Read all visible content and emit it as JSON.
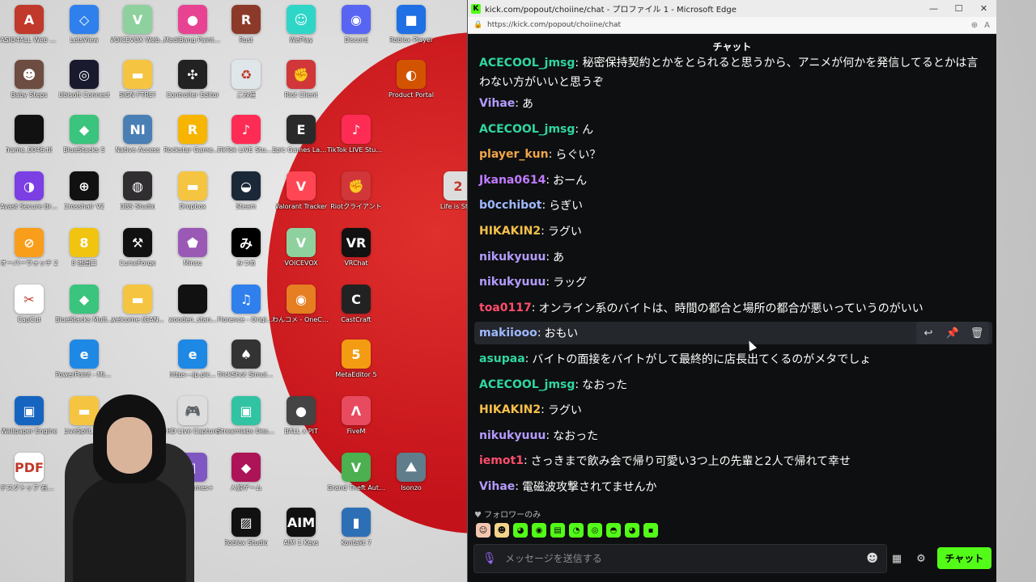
{
  "desktop": {
    "icons": [
      {
        "label": "ASIO4ALL Web Site",
        "color": "#c0392b",
        "glyph": "A"
      },
      {
        "label": "LetsView",
        "color": "#2f80ed",
        "glyph": "◇"
      },
      {
        "label": "VOICEVOX Web...",
        "color": "#8fd19e",
        "glyph": "V"
      },
      {
        "label": "MediBang Paint Pro",
        "color": "#e84393",
        "glyph": "●"
      },
      {
        "label": "Rust",
        "color": "#8b3a2a",
        "glyph": "R"
      },
      {
        "label": "WePlay",
        "color": "#2ed6c8",
        "glyph": "☺"
      },
      {
        "label": "Discord",
        "color": "#5865f2",
        "glyph": "◉"
      },
      {
        "label": "Roblox Player",
        "color": "#1f6fe5",
        "glyph": "■"
      },
      {
        "label": "Baby Steps",
        "color": "#6d4c41",
        "glyph": "☻"
      },
      {
        "label": "Ubisoft Connect",
        "color": "#1a1a2e",
        "glyph": "◎"
      },
      {
        "label": "SIGN FTRE?",
        "color": "#f5c542",
        "glyph": "▬"
      },
      {
        "label": "Controller Editor",
        "color": "#222222",
        "glyph": "✣"
      },
      {
        "label": "ごみ箱",
        "color": "#dfe6e9",
        "glyph": "♻"
      },
      {
        "label": "Riot Client",
        "color": "#d13639",
        "glyph": "✊"
      },
      {
        "label": "Product Portal",
        "color": "#d35400",
        "glyph": "◐"
      },
      {
        "label": "frame_0046.tif",
        "color": "#111111",
        "glyph": ""
      },
      {
        "label": "BlueStacks 5",
        "color": "#3ac47d",
        "glyph": "◆"
      },
      {
        "label": "Native Access",
        "color": "#4a7fb5",
        "glyph": "NI"
      },
      {
        "label": "Rockstar Games Launcher",
        "color": "#f7b500",
        "glyph": "R"
      },
      {
        "label": "TikTok LIVE Studio",
        "color": "#fe2c55",
        "glyph": "♪"
      },
      {
        "label": "Epic Games Launcher",
        "color": "#2a2a2a",
        "glyph": "E"
      },
      {
        "label": "TikTok LIVE Studio",
        "color": "#fe2c55",
        "glyph": "♪"
      },
      {
        "label": "Avast Secure Browser",
        "color": "#7b3fe4",
        "glyph": "◑"
      },
      {
        "label": "Crosshair V2",
        "color": "#111111",
        "glyph": "⊕"
      },
      {
        "label": "OBS Studio",
        "color": "#302e31",
        "glyph": "◍"
      },
      {
        "label": "Dropbox",
        "color": "#f5c542",
        "glyph": "▬"
      },
      {
        "label": "Steam",
        "color": "#1b2838",
        "glyph": "◒"
      },
      {
        "label": "Valorant Tracker",
        "color": "#ff4655",
        "glyph": "V"
      },
      {
        "label": "Riotクライアント",
        "color": "#d13639",
        "glyph": "✊"
      },
      {
        "label": "オーバーウォッチ 2",
        "color": "#f99e1a",
        "glyph": "⊘"
      },
      {
        "label": "8 番出口",
        "color": "#f1c40f",
        "glyph": "8"
      },
      {
        "label": "CurseForge",
        "color": "#111111",
        "glyph": "⚒"
      },
      {
        "label": "Minsu",
        "color": "#9b59b6",
        "glyph": "⬟"
      },
      {
        "label": "みつめ",
        "color": "#000000",
        "glyph": "み"
      },
      {
        "label": "VOICEVOX",
        "color": "#8fd19e",
        "glyph": "V"
      },
      {
        "label": "VRChat",
        "color": "#111111",
        "glyph": "VR"
      },
      {
        "label": "CapCut",
        "color": "#ffffff",
        "glyph": "✂"
      },
      {
        "label": "BlueStacks Multi-Instance",
        "color": "#3ac47d",
        "glyph": "◆"
      },
      {
        "label": "welcome (GAN...",
        "color": "#f5c542",
        "glyph": "▬"
      },
      {
        "label": "wooden_stan...",
        "color": "#111111",
        "glyph": ""
      },
      {
        "label": "Florence - Original S...",
        "color": "#2f80ed",
        "glyph": "♫"
      },
      {
        "label": "わんコメ - OneComme",
        "color": "#e67e22",
        "glyph": "◉"
      },
      {
        "label": "CastCraft",
        "color": "#222222",
        "glyph": "C"
      },
      {
        "label": "PowerPoint - Microsoft 365",
        "color": "#1e88e5",
        "glyph": "e"
      },
      {
        "label": "https---jp.pic...",
        "color": "#1e88e5",
        "glyph": "e"
      },
      {
        "label": "TrickShot Simulator",
        "color": "#333333",
        "glyph": "♠"
      },
      {
        "label": "MetaEditor 5",
        "color": "#f39c12",
        "glyph": "5"
      },
      {
        "label": "Wallpaper Engine",
        "color": "#1565c0",
        "glyph": "▣"
      },
      {
        "label": "LiveSplit_1.8",
        "color": "#f5c542",
        "glyph": "▬"
      },
      {
        "label": "HD Live Capture",
        "color": "#dddddd",
        "glyph": "🎮"
      },
      {
        "label": "Streamlabs Desktop",
        "color": "#31c3a2",
        "glyph": "▣"
      },
      {
        "label": "BALL x PIT",
        "color": "#444444",
        "glyph": "●"
      },
      {
        "label": "FiveM",
        "color": "#e84a5f",
        "glyph": "Λ"
      },
      {
        "label": "デスクトップ 右端 参考.PDF",
        "color": "#ffffff",
        "glyph": "PDF"
      },
      {
        "label": "EpicGames+",
        "color": "#7e57c2",
        "glyph": "▯"
      },
      {
        "label": "人狼ゲーム",
        "color": "#ad1457",
        "glyph": "◆"
      },
      {
        "label": "Grand Theft Auto V",
        "color": "#4caf50",
        "glyph": "V"
      },
      {
        "label": "Isonzo",
        "color": "#607d8b",
        "glyph": "⛰"
      },
      {
        "label": "Roblox Studio",
        "color": "#111111",
        "glyph": "▨"
      },
      {
        "label": "AIM 1 Keys",
        "color": "#111111",
        "glyph": "AIM"
      },
      {
        "label": "Kontakt 7",
        "color": "#2d6fb5",
        "glyph": "▮"
      },
      {
        "label": "Life is Str...",
        "color": "#dddddd",
        "glyph": "2"
      }
    ]
  },
  "window": {
    "title": "kick.com/popout/choiine/chat - プロファイル 1 - Microsoft Edge",
    "url": "https://kick.com/popout/choiine/chat",
    "controls": {
      "minimize": "—",
      "maximize": "☐",
      "close": "✕"
    }
  },
  "chat": {
    "header": "チャット",
    "first_message": {
      "user": "ACECOOL_jmsg",
      "color": "#2fd6a0",
      "text": "秘密保持契約とかをとられると思うから、アニメが何かを発信してるとかは言わない方がいいと思うぞ"
    },
    "messages": [
      {
        "user": "Vihae",
        "color": "#b49bff",
        "text": "あ"
      },
      {
        "user": "ACECOOL_jmsg",
        "color": "#2fd6a0",
        "text": "ん"
      },
      {
        "user": "player_kun",
        "color": "#f0a64a",
        "text": "らぐい？"
      },
      {
        "user": "Jkana0614",
        "color": "#c07bff",
        "text": "おーん"
      },
      {
        "user": "b0cchibot",
        "color": "#9fb8ff",
        "text": "らぎい"
      },
      {
        "user": "HIKAKIN2",
        "color": "#f5c04a",
        "text": "ラグい"
      },
      {
        "user": "nikukyuuu",
        "color": "#b49bff",
        "text": "あ"
      },
      {
        "user": "nikukyuuu",
        "color": "#b49bff",
        "text": "ラッグ"
      },
      {
        "user": "toa0117",
        "color": "#ff4d6d",
        "text": "オンライン系のバイトは、時間の都合と場所の都合が悪いっていうのがいい"
      },
      {
        "user": "makiiooo",
        "color": "#9fb8ff",
        "text": "おもい"
      },
      {
        "user": "asupaa",
        "color": "#2fd6a0",
        "text": "バイトの面接をバイトがして最終的に店長出てくるのがメタでしょ"
      },
      {
        "user": "ACECOOL_jmsg",
        "color": "#2fd6a0",
        "text": "なおった"
      },
      {
        "user": "HIKAKIN2",
        "color": "#f5c04a",
        "text": "ラグい"
      },
      {
        "user": "nikukyuuu",
        "color": "#b49bff",
        "text": "なおった"
      },
      {
        "user": "iemot1",
        "color": "#ff4d6d",
        "text": "さっきまで飲み会で帰り可愛い3つ上の先輩と2人で帰れて幸せ"
      },
      {
        "user": "Vihae",
        "color": "#b49bff",
        "text": "電磁波攻撃されてませんか"
      }
    ],
    "hover_actions": {
      "reply": "↩",
      "pin": "📌",
      "delete": "🗑"
    },
    "follower_mode": "フォロワーのみ",
    "emotes": [
      {
        "color": "#f3c6b0",
        "glyph": "☺"
      },
      {
        "color": "#f3d38a",
        "glyph": "☻"
      },
      {
        "color": "#53fc18",
        "glyph": "◕"
      },
      {
        "color": "#53fc18",
        "glyph": "◉"
      },
      {
        "color": "#53fc18",
        "glyph": "▤"
      },
      {
        "color": "#53fc18",
        "glyph": "◔"
      },
      {
        "color": "#53fc18",
        "glyph": "◎"
      },
      {
        "color": "#53fc18",
        "glyph": "◓"
      },
      {
        "color": "#53fc18",
        "glyph": "◕"
      },
      {
        "color": "#53fc18",
        "glyph": "▪"
      }
    ],
    "input": {
      "placeholder": "メッセージを送信する",
      "value": ""
    },
    "send_label": "チャット",
    "accent": "#53fc18"
  }
}
